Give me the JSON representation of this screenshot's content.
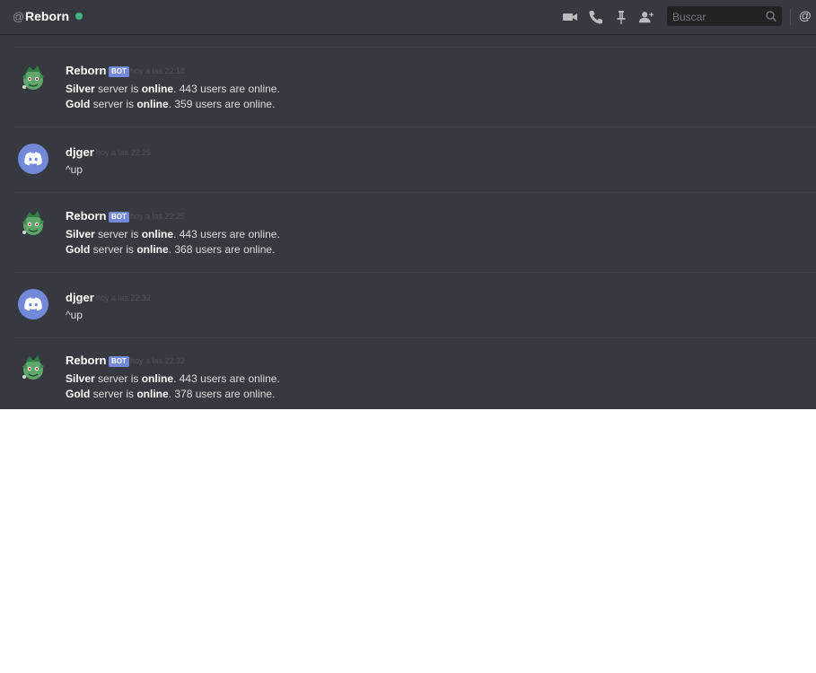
{
  "header": {
    "at_symbol": "@",
    "channel_name": "Reborn",
    "status_color": "#43b581",
    "icons": [
      "video-camera-icon",
      "phone-icon",
      "pin-icon",
      "add-friend-icon"
    ],
    "search_placeholder": "Buscar",
    "mention_symbol": "@"
  },
  "colors": {
    "background": "#36393f",
    "blurple": "#7289da",
    "online": "#43b581"
  },
  "messages": [
    {
      "author": "Reborn",
      "bot_tag": "BOT",
      "timestamp": "hoy a las 22:18",
      "avatar": "bulbasaur-avatar",
      "lines": [
        {
          "bold": "Silver",
          "t1": " server is ",
          "bold2": "online",
          "t2": ". 443 users are online."
        },
        {
          "bold": "Gold",
          "t1": " server is ",
          "bold2": "online",
          "t2": ". 359 users are online."
        }
      ]
    },
    {
      "author": "djger",
      "timestamp": "hoy a las 22:25",
      "avatar": "discord-default-avatar",
      "lines": [
        {
          "text": "^up"
        }
      ]
    },
    {
      "author": "Reborn",
      "bot_tag": "BOT",
      "timestamp": "hoy a las 22:25",
      "avatar": "bulbasaur-avatar",
      "lines": [
        {
          "bold": "Silver",
          "t1": " server is ",
          "bold2": "online",
          "t2": ". 443 users are online."
        },
        {
          "bold": "Gold",
          "t1": " server is ",
          "bold2": "online",
          "t2": ". 368 users are online."
        }
      ]
    },
    {
      "author": "djger",
      "timestamp": "hoy a las 22:32",
      "avatar": "discord-default-avatar",
      "lines": [
        {
          "text": "^up"
        }
      ]
    },
    {
      "author": "Reborn",
      "bot_tag": "BOT",
      "timestamp": "hoy a las 22:32",
      "avatar": "bulbasaur-avatar",
      "lines": [
        {
          "bold": "Silver",
          "t1": " server is ",
          "bold2": "online",
          "t2": ". 443 users are online."
        },
        {
          "bold": "Gold",
          "t1": " server is ",
          "bold2": "online",
          "t2": ". 378 users are online."
        }
      ]
    }
  ]
}
